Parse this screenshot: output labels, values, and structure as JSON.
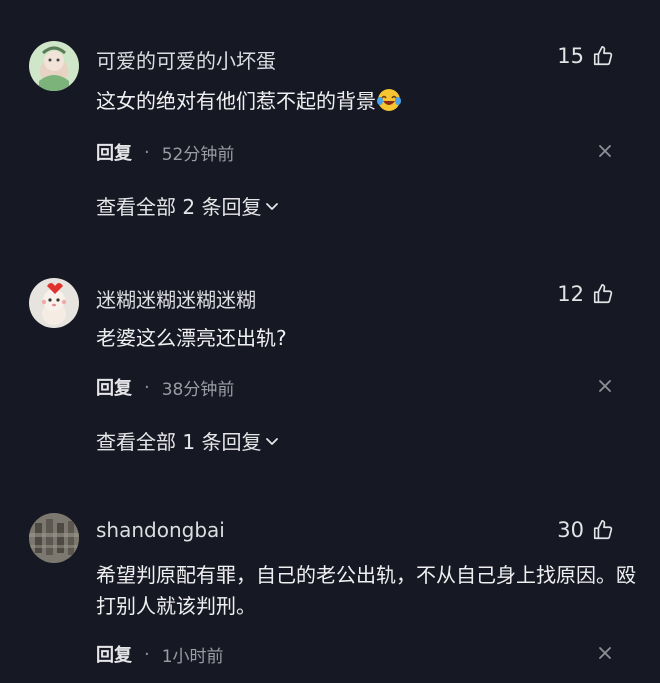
{
  "comments": [
    {
      "username": "可爱的可爱的小坏蛋",
      "likes": "15",
      "text": "这女的绝对有他们惹不起的背景",
      "emoji": "laughing-crying-emoji",
      "reply_label": "回复",
      "separator": "·",
      "time": "52分钟前",
      "view_replies": "查看全部 2 条回复"
    },
    {
      "username": "迷糊迷糊迷糊迷糊",
      "likes": "12",
      "text": "老婆这么漂亮还出轨?",
      "reply_label": "回复",
      "separator": "·",
      "time": "38分钟前",
      "view_replies": "查看全部 1 条回复"
    },
    {
      "username": "shandongbai",
      "likes": "30",
      "text": "希望判原配有罪，自己的老公出轨，不从自己身上找原因。殴打别人就该判刑。",
      "reply_label": "回复",
      "separator": "·",
      "time": "1小时前"
    }
  ],
  "icons": {
    "like": "thumbs-up-icon",
    "dismiss": "close-icon",
    "expand": "chevron-down-icon"
  },
  "colors": {
    "background": "#161823",
    "text_primary": "#f0f0f2",
    "text_secondary": "#9a9ca4"
  }
}
